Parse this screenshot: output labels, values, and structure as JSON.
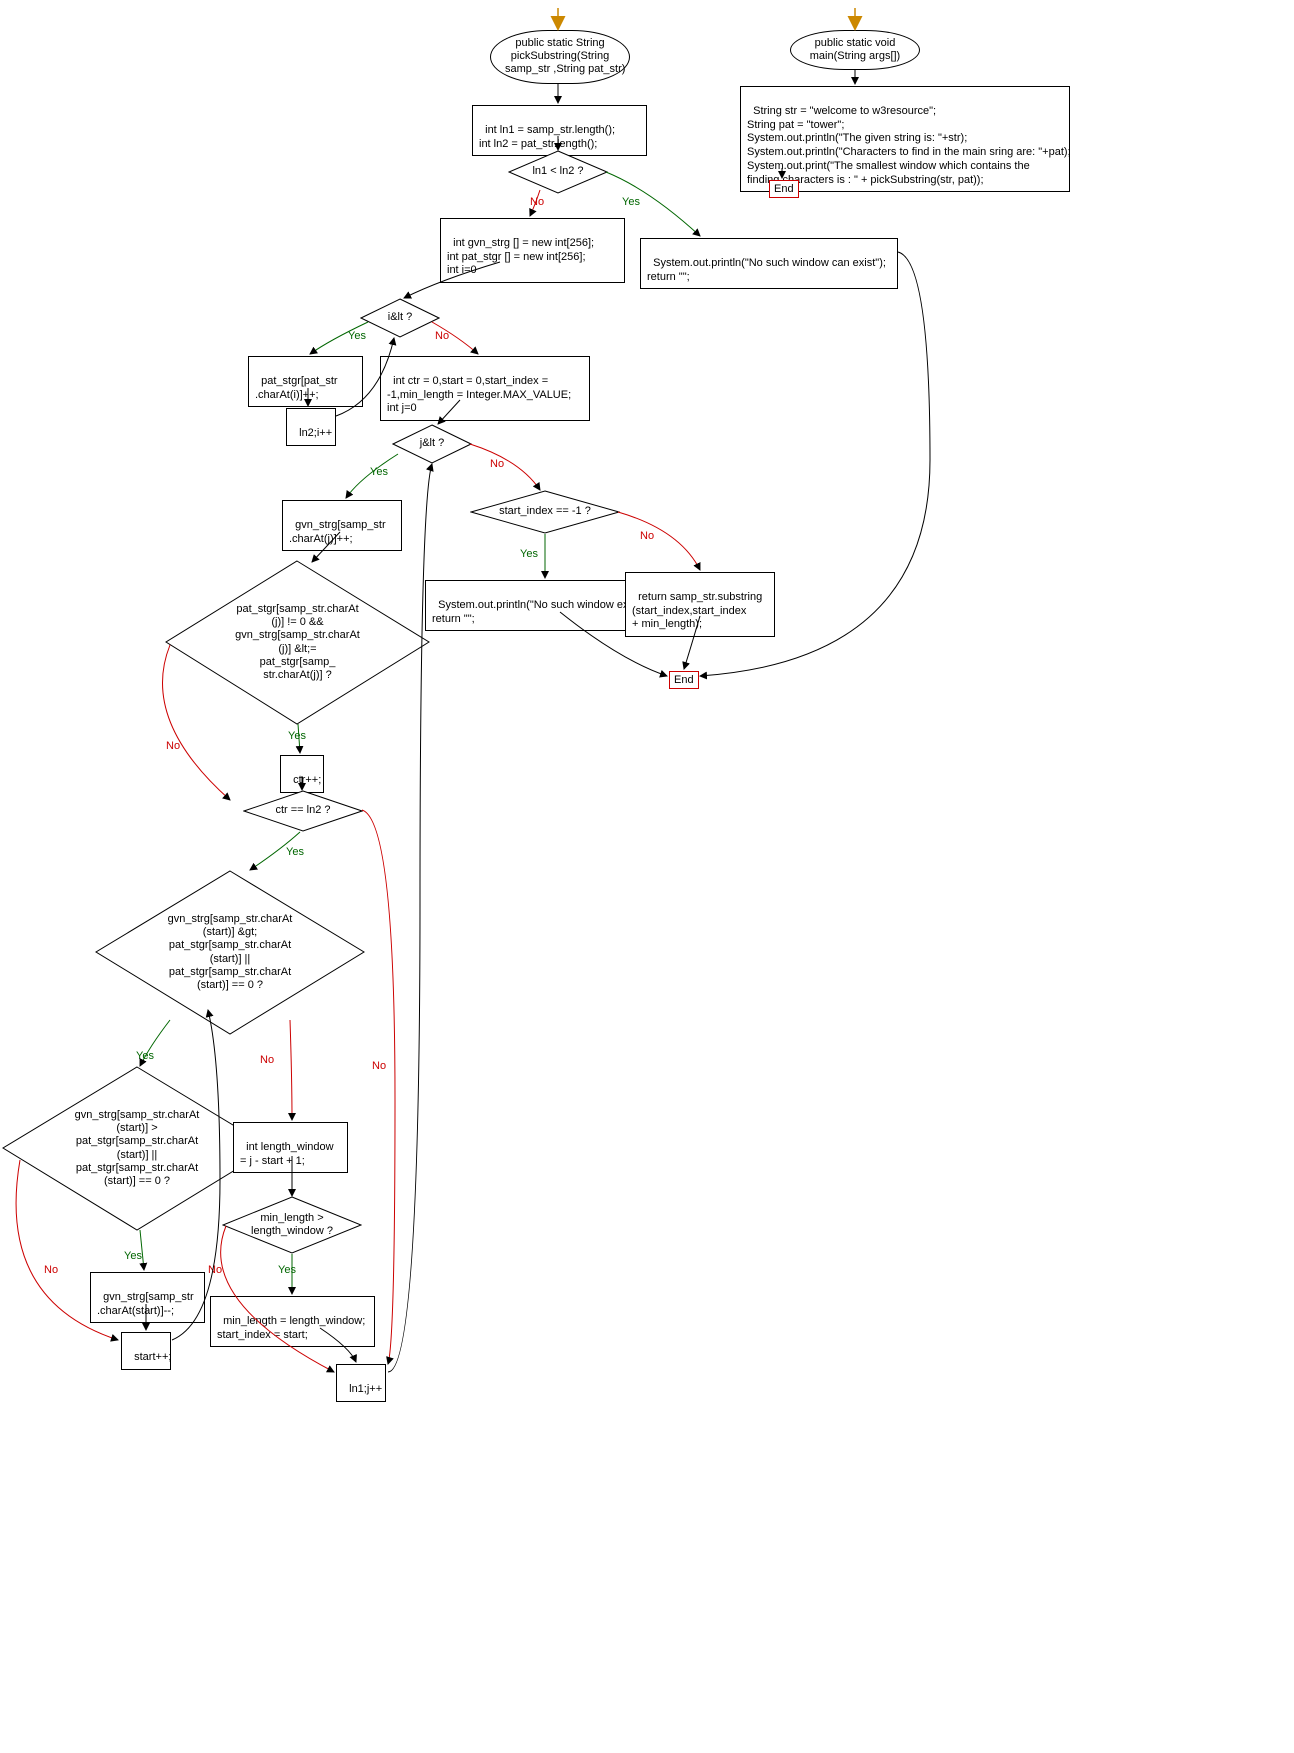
{
  "nodes": {
    "start1": "public static String\npickSubstring(String\nsamp_str ,String pat_str)",
    "start2": "public static void\nmain(String args[])",
    "p1": "int ln1 = samp_str.length();\nint ln2 = pat_str.length();",
    "d1": "ln1 < ln2 ?",
    "p2": "int gvn_strg [] = new int[256];\nint pat_stgr [] = new int[256];\nint i=0",
    "p3": "System.out.println(\"No such window can exist\");\nreturn \"\";",
    "d2": "i&lt ?",
    "p4": "pat_stgr[pat_str\n.charAt(i)]++;",
    "p5": "ln2;i++",
    "p6": "int ctr = 0,start = 0,start_index =\n-1,min_length = Integer.MAX_VALUE;\nint j=0",
    "d3": "j&lt ?",
    "p7": "gvn_strg[samp_str\n.charAt(j)]++;",
    "d4": "start_index == -1 ?",
    "p8": "System.out.println(\"No such window exists\");\nreturn \"\";",
    "p9": "return samp_str.substring\n(start_index,start_index\n+ min_length);",
    "d5": "pat_stgr[samp_str.charAt\n(j)] != 0 &&\ngvn_strg[samp_str.charAt\n(j)] &lt;=\npat_stgr[samp_\nstr.charAt(j)] ?",
    "p10": "ctr++;",
    "d6": "ctr == ln2 ?",
    "d7": "gvn_strg[samp_str.charAt\n(start)] &gt;\npat_stgr[samp_str.charAt\n(start)] ||\npat_stgr[samp_str.charAt\n(start)] == 0 ?",
    "d8": "gvn_strg[samp_str.charAt\n(start)] >\npat_stgr[samp_str.charAt\n(start)] ||\npat_stgr[samp_str.charAt\n(start)] == 0 ?",
    "p11": "gvn_strg[samp_str\n.charAt(start)]--;",
    "p12": "start++;",
    "p13": "int length_window\n= j - start + 1;",
    "d9": "min_length >\nlength_window ?",
    "p14": "min_length = length_window;\nstart_index = start;",
    "p15": "ln1;j++",
    "end1": "End",
    "end2": "End",
    "mainbody": "String str = \"welcome to w3resource\";\nString pat = \"tower\";\nSystem.out.println(\"The given string is: \"+str);\nSystem.out.println(\"Characters to find in the main sring are: \"+pat);\nSystem.out.print(\"The smallest window which contains the\nfinding characters is : \" + pickSubstring(str, pat));"
  },
  "labels": {
    "yes": "Yes",
    "no": "No"
  },
  "chart_data": {
    "type": "flowchart",
    "functions": [
      {
        "name": "pickSubstring",
        "signature": "public static String pickSubstring(String samp_str, String pat_str)",
        "start": "start1"
      },
      {
        "name": "main",
        "signature": "public static void main(String args[])",
        "start": "start2"
      }
    ],
    "edges": [
      [
        "start1",
        "p1",
        null
      ],
      [
        "p1",
        "d1",
        null
      ],
      [
        "d1",
        "p2",
        "No"
      ],
      [
        "d1",
        "p3",
        "Yes"
      ],
      [
        "p3",
        "end1",
        null
      ],
      [
        "p2",
        "d2",
        null
      ],
      [
        "d2",
        "p4",
        "Yes"
      ],
      [
        "p4",
        "p5",
        null
      ],
      [
        "p5",
        "d2",
        null
      ],
      [
        "d2",
        "p6",
        "No"
      ],
      [
        "p6",
        "d3",
        null
      ],
      [
        "d3",
        "p7",
        "Yes"
      ],
      [
        "d3",
        "d4",
        "No"
      ],
      [
        "d4",
        "p8",
        "Yes"
      ],
      [
        "d4",
        "p9",
        "No"
      ],
      [
        "p8",
        "end1",
        null
      ],
      [
        "p9",
        "end1",
        null
      ],
      [
        "p7",
        "d5",
        null
      ],
      [
        "d5",
        "p10",
        "Yes"
      ],
      [
        "d5",
        "d6",
        "No"
      ],
      [
        "p10",
        "d6",
        null
      ],
      [
        "d6",
        "d7",
        "Yes"
      ],
      [
        "d6",
        "p15",
        "No"
      ],
      [
        "d7",
        "d8",
        "Yes"
      ],
      [
        "d7",
        "p13",
        "No"
      ],
      [
        "d8",
        "p11",
        "Yes"
      ],
      [
        "d8",
        "p12",
        "No"
      ],
      [
        "p11",
        "p12",
        null
      ],
      [
        "p12",
        "d7",
        null
      ],
      [
        "p13",
        "d9",
        null
      ],
      [
        "d9",
        "p14",
        "Yes"
      ],
      [
        "d9",
        "p15",
        "No"
      ],
      [
        "p14",
        "p15",
        null
      ],
      [
        "p15",
        "d3",
        null
      ],
      [
        "start2",
        "mainbody",
        null
      ],
      [
        "mainbody",
        "end2",
        null
      ]
    ]
  }
}
